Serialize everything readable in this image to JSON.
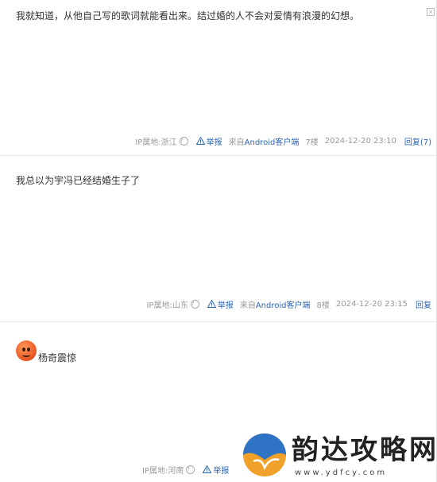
{
  "posts": [
    {
      "content": "我就知道，从他自己写的歌词就能看出来。结过婚的人不会对爱情有浪漫的幻想。",
      "ip": "IP属地:浙江",
      "report": "举报",
      "from_prefix": "来自",
      "from_client": "Android客户端",
      "floor": "7楼",
      "time": "2024-12-20 23:10",
      "reply": "回复(7)"
    },
    {
      "content": "我总以为宇冯已经结婚生子了",
      "ip": "IP属地:山东",
      "report": "举报",
      "from_prefix": "来自",
      "from_client": "Android客户端",
      "floor": "8楼",
      "time": "2024-12-20 23:15",
      "reply": "回复"
    },
    {
      "username": "杨奇震惊",
      "ip": "IP属地:河南",
      "report": "举报"
    }
  ],
  "icons": {
    "help": "?",
    "close": "×",
    "warning": "warning-triangle-icon",
    "avatar": "orange-emoji-avatar"
  },
  "watermark": {
    "title": "韵达攻略网",
    "url": "www.ydfcy.com"
  },
  "colors": {
    "link": "#2d64b3",
    "meta": "#999999",
    "text": "#333333"
  }
}
